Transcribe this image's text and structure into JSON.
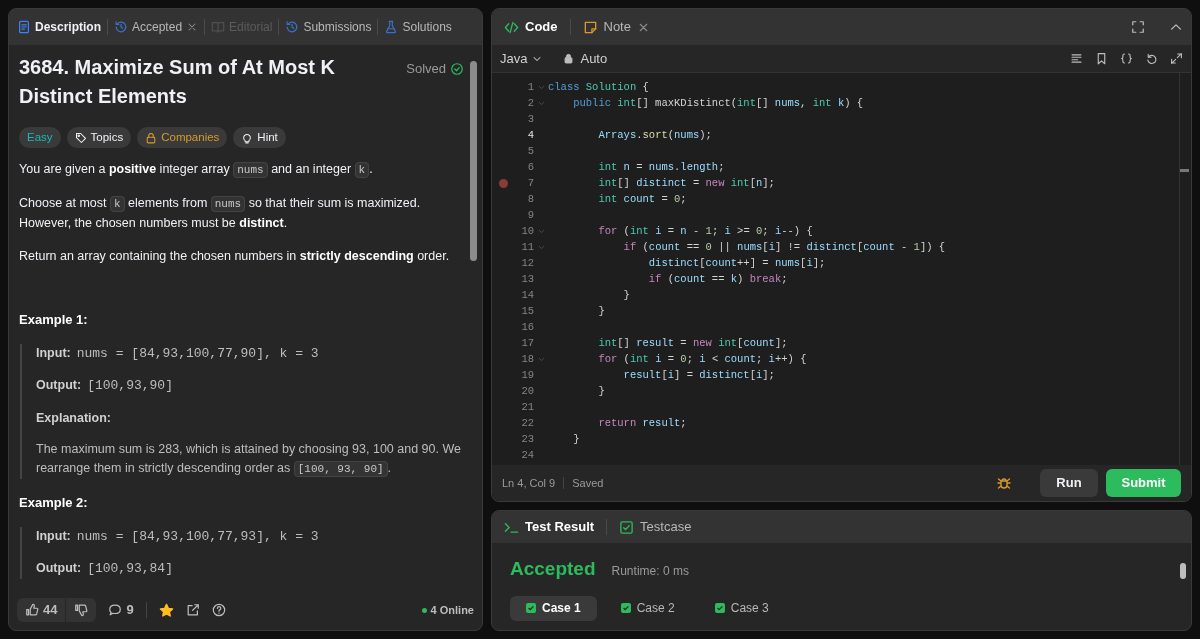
{
  "description_panel": {
    "tabs": [
      {
        "label": "Description",
        "selected": true,
        "disabled": false,
        "closable": false
      },
      {
        "label": "Accepted",
        "selected": false,
        "disabled": false,
        "closable": true
      },
      {
        "label": "Editorial",
        "selected": false,
        "disabled": true,
        "closable": false
      },
      {
        "label": "Submissions",
        "selected": false,
        "disabled": false,
        "closable": false
      },
      {
        "label": "Solutions",
        "selected": false,
        "disabled": false,
        "closable": false
      }
    ],
    "title": "3684. Maximize Sum of At Most K Distinct Elements",
    "solved_label": "Solved",
    "tags": [
      {
        "label": "Easy",
        "color": "#1cb8b8"
      },
      {
        "label": "Topics",
        "color": "#eff1f6"
      },
      {
        "label": "Companies",
        "color": "#d89b2a"
      },
      {
        "label": "Hint",
        "color": "#eff1f6"
      }
    ],
    "paragraphs": [
      [
        {
          "kind": "t",
          "text": "You are given a "
        },
        {
          "kind": "b",
          "text": "positive"
        },
        {
          "kind": "t",
          "text": " integer array "
        },
        {
          "kind": "c",
          "text": "nums"
        },
        {
          "kind": "t",
          "text": " and an integer "
        },
        {
          "kind": "c",
          "text": "k"
        },
        {
          "kind": "t",
          "text": "."
        }
      ],
      [
        {
          "kind": "t",
          "text": "Choose at most "
        },
        {
          "kind": "c",
          "text": "k"
        },
        {
          "kind": "t",
          "text": " elements from "
        },
        {
          "kind": "c",
          "text": "nums"
        },
        {
          "kind": "t",
          "text": " so that their sum is maximized. However, the chosen numbers must be "
        },
        {
          "kind": "b",
          "text": "distinct"
        },
        {
          "kind": "t",
          "text": "."
        }
      ],
      [
        {
          "kind": "t",
          "text": "Return an array containing the chosen numbers in "
        },
        {
          "kind": "b",
          "text": "strictly descending"
        },
        {
          "kind": "t",
          "text": " order."
        }
      ]
    ],
    "examples": [
      {
        "heading": "Example 1:",
        "input_label": "Input:",
        "input": "nums = [84,93,100,77,90], k = 3",
        "output_label": "Output:",
        "output": "[100,93,90]",
        "explanation_label": "Explanation:",
        "explanation": [
          {
            "kind": "t",
            "text": "The maximum sum is 283, which is attained by choosing 93, 100 and 90. We rearrange them in strictly descending order as "
          },
          {
            "kind": "c",
            "text": "[100, 93, 90]"
          },
          {
            "kind": "t",
            "text": "."
          }
        ]
      },
      {
        "heading": "Example 2:",
        "input_label": "Input:",
        "input": "nums = [84,93,100,77,93], k = 3",
        "output_label": "Output:",
        "output": "[100,93,84]"
      }
    ],
    "footer": {
      "likes": "44",
      "comments": "9",
      "favorited": true,
      "online": "4 Online"
    }
  },
  "editor": {
    "tabs": [
      {
        "label": "Code",
        "selected": true,
        "closable": false
      },
      {
        "label": "Note",
        "selected": false,
        "closable": true
      }
    ],
    "language": "Java",
    "mode": "Auto",
    "lines": [
      {
        "n": "1",
        "fold": true,
        "tokens": [
          {
            "kind": "kw",
            "text": "class "
          },
          {
            "kind": "type",
            "text": "Solution"
          },
          {
            "kind": "p",
            "text": " {"
          }
        ]
      },
      {
        "n": "2",
        "fold": true,
        "tokens": [
          {
            "kind": "kw",
            "text": "    public "
          },
          {
            "kind": "type",
            "text": "int"
          },
          {
            "kind": "p",
            "text": "[] maxKDistinct("
          },
          {
            "kind": "type",
            "text": "int"
          },
          {
            "kind": "p",
            "text": "[] "
          },
          {
            "kind": "id",
            "text": "nums"
          },
          {
            "kind": "p",
            "text": ", "
          },
          {
            "kind": "type",
            "text": "int"
          },
          {
            "kind": "id",
            "text": " k"
          },
          {
            "kind": "p",
            "text": ") {"
          }
        ]
      },
      {
        "n": "3"
      },
      {
        "n": "4",
        "current": true,
        "tokens": [
          {
            "kind": "id",
            "text": "        Arrays"
          },
          {
            "kind": "p",
            "text": "."
          },
          {
            "kind": "fn",
            "text": "sort"
          },
          {
            "kind": "p",
            "text": "("
          },
          {
            "kind": "id",
            "text": "nums"
          },
          {
            "kind": "p",
            "text": ");"
          }
        ]
      },
      {
        "n": "5"
      },
      {
        "n": "6",
        "tokens": [
          {
            "kind": "type",
            "text": "        int"
          },
          {
            "kind": "id",
            "text": " n"
          },
          {
            "kind": "p",
            "text": " = "
          },
          {
            "kind": "id",
            "text": "nums"
          },
          {
            "kind": "p",
            "text": "."
          },
          {
            "kind": "id",
            "text": "length"
          },
          {
            "kind": "p",
            "text": ";"
          }
        ]
      },
      {
        "n": "7",
        "breakpoint": true,
        "tokens": [
          {
            "kind": "type",
            "text": "        int"
          },
          {
            "kind": "p",
            "text": "[] "
          },
          {
            "kind": "id",
            "text": "distinct"
          },
          {
            "kind": "p",
            "text": " = "
          },
          {
            "kind": "ctl",
            "text": "new "
          },
          {
            "kind": "type",
            "text": "int"
          },
          {
            "kind": "p",
            "text": "["
          },
          {
            "kind": "id",
            "text": "n"
          },
          {
            "kind": "p",
            "text": "];"
          }
        ]
      },
      {
        "n": "8",
        "tokens": [
          {
            "kind": "type",
            "text": "        int"
          },
          {
            "kind": "id",
            "text": " count"
          },
          {
            "kind": "p",
            "text": " = "
          },
          {
            "kind": "num",
            "text": "0"
          },
          {
            "kind": "p",
            "text": ";"
          }
        ]
      },
      {
        "n": "9"
      },
      {
        "n": "10",
        "fold": true,
        "tokens": [
          {
            "kind": "ctl",
            "text": "        for"
          },
          {
            "kind": "p",
            "text": " ("
          },
          {
            "kind": "type",
            "text": "int"
          },
          {
            "kind": "id",
            "text": " i"
          },
          {
            "kind": "p",
            "text": " = "
          },
          {
            "kind": "id",
            "text": "n"
          },
          {
            "kind": "p",
            "text": " - "
          },
          {
            "kind": "num",
            "text": "1"
          },
          {
            "kind": "p",
            "text": "; "
          },
          {
            "kind": "id",
            "text": "i"
          },
          {
            "kind": "p",
            "text": " >= "
          },
          {
            "kind": "num",
            "text": "0"
          },
          {
            "kind": "p",
            "text": "; "
          },
          {
            "kind": "id",
            "text": "i"
          },
          {
            "kind": "p",
            "text": "--) {"
          }
        ]
      },
      {
        "n": "11",
        "fold": true,
        "tokens": [
          {
            "kind": "ctl",
            "text": "            if"
          },
          {
            "kind": "p",
            "text": " ("
          },
          {
            "kind": "id",
            "text": "count"
          },
          {
            "kind": "p",
            "text": " == "
          },
          {
            "kind": "num",
            "text": "0"
          },
          {
            "kind": "p",
            "text": " || "
          },
          {
            "kind": "id",
            "text": "nums"
          },
          {
            "kind": "p",
            "text": "["
          },
          {
            "kind": "id",
            "text": "i"
          },
          {
            "kind": "p",
            "text": "] != "
          },
          {
            "kind": "id",
            "text": "distinct"
          },
          {
            "kind": "p",
            "text": "["
          },
          {
            "kind": "id",
            "text": "count"
          },
          {
            "kind": "p",
            "text": " - "
          },
          {
            "kind": "num",
            "text": "1"
          },
          {
            "kind": "p",
            "text": "]) {"
          }
        ]
      },
      {
        "n": "12",
        "tokens": [
          {
            "kind": "id",
            "text": "                distinct"
          },
          {
            "kind": "p",
            "text": "["
          },
          {
            "kind": "id",
            "text": "count"
          },
          {
            "kind": "p",
            "text": "++] = "
          },
          {
            "kind": "id",
            "text": "nums"
          },
          {
            "kind": "p",
            "text": "["
          },
          {
            "kind": "id",
            "text": "i"
          },
          {
            "kind": "p",
            "text": "];"
          }
        ]
      },
      {
        "n": "13",
        "tokens": [
          {
            "kind": "ctl",
            "text": "                if"
          },
          {
            "kind": "p",
            "text": " ("
          },
          {
            "kind": "id",
            "text": "count"
          },
          {
            "kind": "p",
            "text": " == "
          },
          {
            "kind": "id",
            "text": "k"
          },
          {
            "kind": "p",
            "text": ") "
          },
          {
            "kind": "ctl",
            "text": "break"
          },
          {
            "kind": "p",
            "text": ";"
          }
        ]
      },
      {
        "n": "14",
        "tokens": [
          {
            "kind": "p",
            "text": "            }"
          }
        ]
      },
      {
        "n": "15",
        "tokens": [
          {
            "kind": "p",
            "text": "        }"
          }
        ]
      },
      {
        "n": "16"
      },
      {
        "n": "17",
        "tokens": [
          {
            "kind": "type",
            "text": "        int"
          },
          {
            "kind": "p",
            "text": "[] "
          },
          {
            "kind": "id",
            "text": "result"
          },
          {
            "kind": "p",
            "text": " = "
          },
          {
            "kind": "ctl",
            "text": "new "
          },
          {
            "kind": "type",
            "text": "int"
          },
          {
            "kind": "p",
            "text": "["
          },
          {
            "kind": "id",
            "text": "count"
          },
          {
            "kind": "p",
            "text": "];"
          }
        ]
      },
      {
        "n": "18",
        "fold": true,
        "tokens": [
          {
            "kind": "ctl",
            "text": "        for"
          },
          {
            "kind": "p",
            "text": " ("
          },
          {
            "kind": "type",
            "text": "int"
          },
          {
            "kind": "id",
            "text": " i"
          },
          {
            "kind": "p",
            "text": " = "
          },
          {
            "kind": "num",
            "text": "0"
          },
          {
            "kind": "p",
            "text": "; "
          },
          {
            "kind": "id",
            "text": "i"
          },
          {
            "kind": "p",
            "text": " < "
          },
          {
            "kind": "id",
            "text": "count"
          },
          {
            "kind": "p",
            "text": "; "
          },
          {
            "kind": "id",
            "text": "i"
          },
          {
            "kind": "p",
            "text": "++) {"
          }
        ]
      },
      {
        "n": "19",
        "tokens": [
          {
            "kind": "id",
            "text": "            result"
          },
          {
            "kind": "p",
            "text": "["
          },
          {
            "kind": "id",
            "text": "i"
          },
          {
            "kind": "p",
            "text": "] = "
          },
          {
            "kind": "id",
            "text": "distinct"
          },
          {
            "kind": "p",
            "text": "["
          },
          {
            "kind": "id",
            "text": "i"
          },
          {
            "kind": "p",
            "text": "];"
          }
        ]
      },
      {
        "n": "20",
        "tokens": [
          {
            "kind": "p",
            "text": "        }"
          }
        ]
      },
      {
        "n": "21"
      },
      {
        "n": "22",
        "tokens": [
          {
            "kind": "ctl",
            "text": "        return"
          },
          {
            "kind": "id",
            "text": " result"
          },
          {
            "kind": "p",
            "text": ";"
          }
        ]
      },
      {
        "n": "23",
        "tokens": [
          {
            "kind": "p",
            "text": "    }"
          }
        ]
      },
      {
        "n": "24"
      }
    ],
    "cursor": "Ln 4, Col 9",
    "save_state": "Saved",
    "buttons": [
      {
        "label": "Run",
        "kind": "secondary"
      },
      {
        "label": "Submit",
        "kind": "primary"
      }
    ]
  },
  "results": {
    "tabs": [
      {
        "label": "Test Result",
        "selected": true
      },
      {
        "label": "Testcase",
        "selected": false
      }
    ],
    "verdict": "Accepted",
    "runtime": "Runtime: 0 ms",
    "cases": [
      {
        "label": "Case 1",
        "selected": true,
        "passed": true
      },
      {
        "label": "Case 2",
        "selected": false,
        "passed": true
      },
      {
        "label": "Case 3",
        "selected": false,
        "passed": true
      }
    ]
  }
}
